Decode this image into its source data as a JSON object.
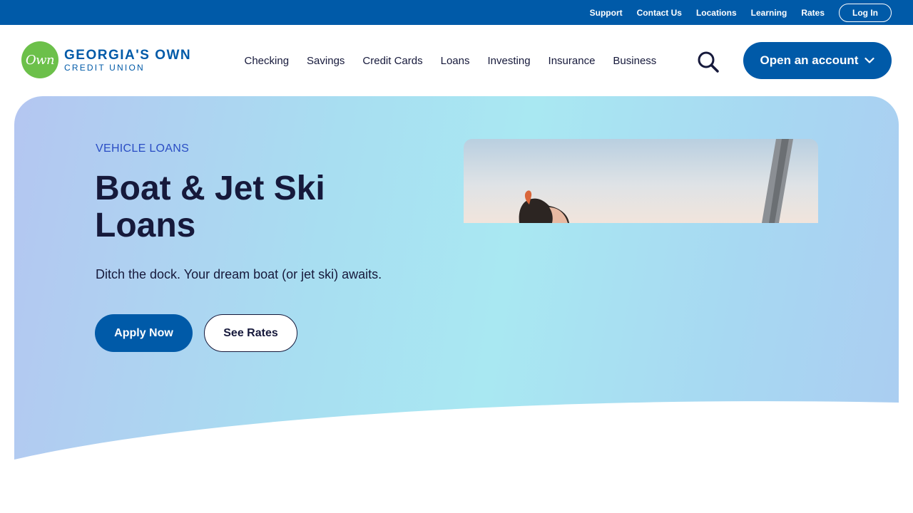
{
  "utility_nav": {
    "links": [
      "Support",
      "Contact Us",
      "Locations",
      "Learning",
      "Rates"
    ],
    "login_label": "Log In"
  },
  "brand": {
    "logo_mark_text": "Own",
    "name": "GEORGIA'S OWN",
    "sub": "CREDIT UNION",
    "colors": {
      "primary": "#005aa8",
      "logo_green": "#6cc04a",
      "text_dark": "#16193b",
      "eyebrow_blue": "#2a4dc4"
    }
  },
  "main_nav": {
    "items": [
      "Checking",
      "Savings",
      "Credit Cards",
      "Loans",
      "Investing",
      "Insurance",
      "Business"
    ],
    "search_icon": "search-icon",
    "cta_label": "Open an account",
    "cta_icon": "chevron-down-icon"
  },
  "hero": {
    "eyebrow": "VEHICLE LOANS",
    "title": "Boat & Jet Ski Loans",
    "subtitle": "Ditch the dock. Your dream boat (or jet ski) awaits.",
    "primary_button": "Apply Now",
    "secondary_button": "See Rates"
  }
}
